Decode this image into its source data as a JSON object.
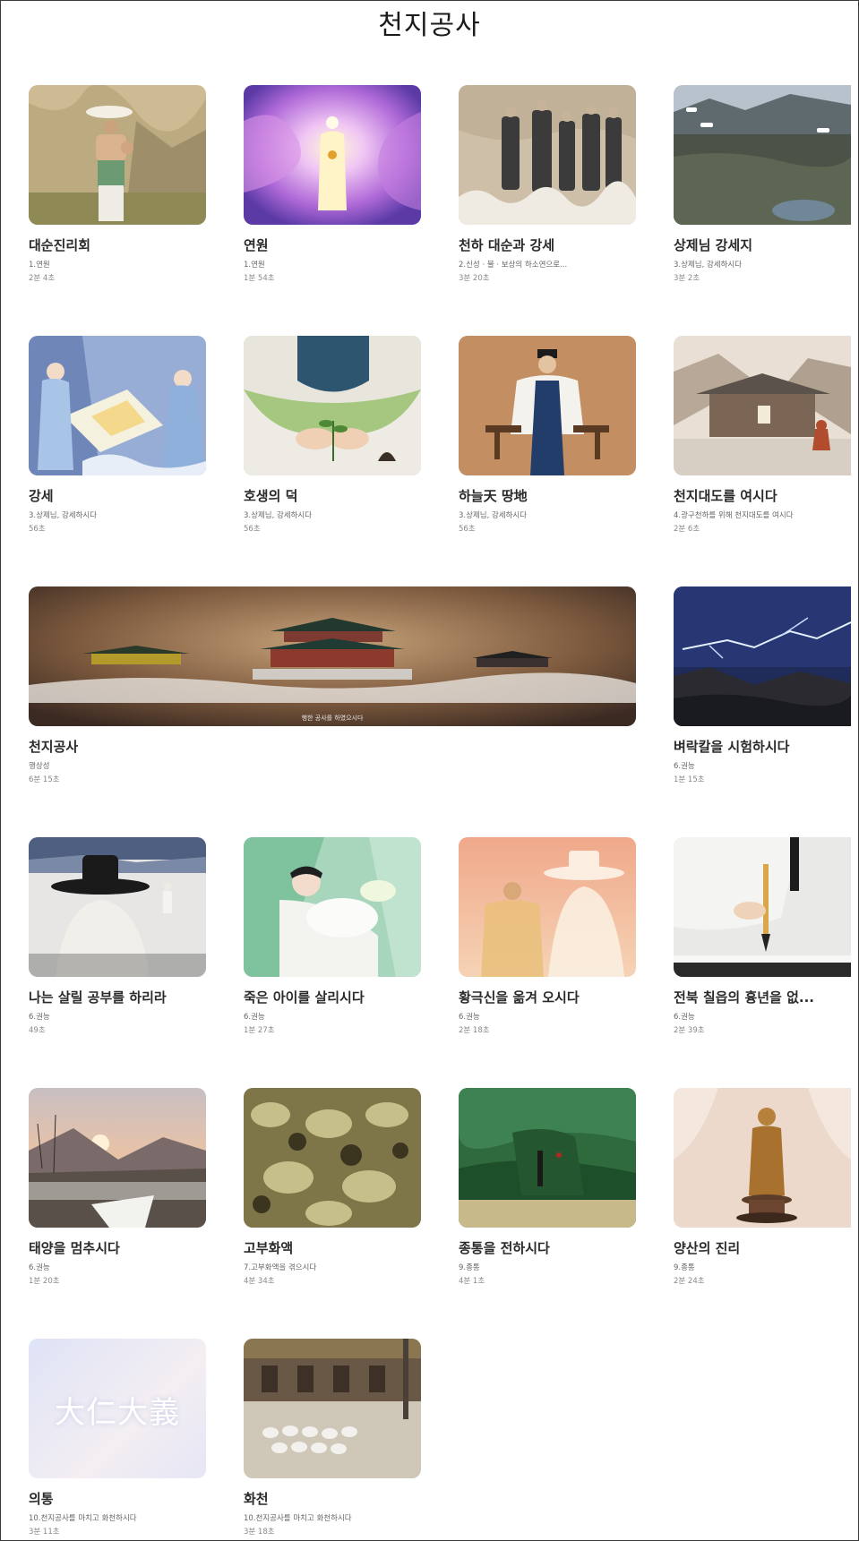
{
  "page": {
    "title": "천지공사"
  },
  "videos": [
    {
      "title": "대순진리회",
      "chapter": "1.연원",
      "duration": "2분 4초",
      "thumb_icon": "woman-carrying-basket-thumbnail"
    },
    {
      "title": "연원",
      "chapter": "1.연원",
      "duration": "1분 54초",
      "thumb_icon": "glowing-figure-thumbnail"
    },
    {
      "title": "천하 대순과 강세",
      "chapter": "2.신성 · 불 · 보상의 하소연으로...",
      "duration": "3분 20초",
      "thumb_icon": "officials-on-clouds-thumbnail"
    },
    {
      "title": "상제님 강세지",
      "chapter": "3.상제님, 강세하시다",
      "duration": "3분 2초",
      "thumb_icon": "village-aerial-thumbnail"
    },
    {
      "title": "강세",
      "chapter": "3.상제님, 강세하시다",
      "duration": "56초",
      "thumb_icon": "heavenly-maidens-thumbnail"
    },
    {
      "title": "호생의 덕",
      "chapter": "3.상제님, 강세하시다",
      "duration": "56초",
      "thumb_icon": "hands-with-plant-thumbnail"
    },
    {
      "title": "하늘天 땅地",
      "chapter": "3.상제님, 강세하시다",
      "duration": "56초",
      "thumb_icon": "seated-figure-thumbnail"
    },
    {
      "title": "천지대도를 여시다",
      "chapter": "4.광구천하를 위해 천지대도를 여시다",
      "duration": "2분 6초",
      "thumb_icon": "mountain-house-thumbnail"
    },
    {
      "title": "천지공사",
      "chapter": "행상성",
      "duration": "6분 15초",
      "thumb_icon": "palace-in-clouds-thumbnail",
      "overlay_caption": "행한 공사를 하였으시다"
    },
    {
      "title": "벼락칼을 시험하시다",
      "chapter": "6.권능",
      "duration": "1분 15초",
      "thumb_icon": "lightning-storm-thumbnail"
    },
    {
      "title": "나는 살릴 공부를 하리라",
      "chapter": "6.권능",
      "duration": "49초",
      "thumb_icon": "man-with-gat-thumbnail"
    },
    {
      "title": "죽은 아이를 살리시다",
      "chapter": "6.권능",
      "duration": "1분 27초",
      "thumb_icon": "woman-holding-child-thumbnail"
    },
    {
      "title": "황극신을 옮겨 오시다",
      "chapter": "6.권능",
      "duration": "2분 18초",
      "thumb_icon": "emperor-silhouette-thumbnail"
    },
    {
      "title": "전북 칠읍의 흉년을 없...",
      "chapter": "6.권능",
      "duration": "2분 39초",
      "thumb_icon": "brush-writing-thumbnail"
    },
    {
      "title": "태양을 멈추시다",
      "chapter": "6.권능",
      "duration": "1분 20초",
      "thumb_icon": "winter-sunset-thumbnail"
    },
    {
      "title": "고부화액",
      "chapter": "7.고부화액을 겪으시다",
      "duration": "4분 34초",
      "thumb_icon": "crowd-scene-thumbnail"
    },
    {
      "title": "종통을 전하시다",
      "chapter": "9.종통",
      "duration": "4분 1초",
      "thumb_icon": "green-cloth-thumbnail"
    },
    {
      "title": "양산의 진리",
      "chapter": "9.종통",
      "duration": "2분 24초",
      "thumb_icon": "golden-statue-thumbnail"
    },
    {
      "title": "의통",
      "chapter": "10.천지공사를 마치고 화천하시다",
      "duration": "3분 11초",
      "thumb_icon": "calligraphy-thumbnail",
      "overlay_text": "大仁大義"
    },
    {
      "title": "화천",
      "chapter": "10.천지공사를 마치고 화천하시다",
      "duration": "3분 18초",
      "thumb_icon": "courtyard-mourners-thumbnail"
    }
  ]
}
